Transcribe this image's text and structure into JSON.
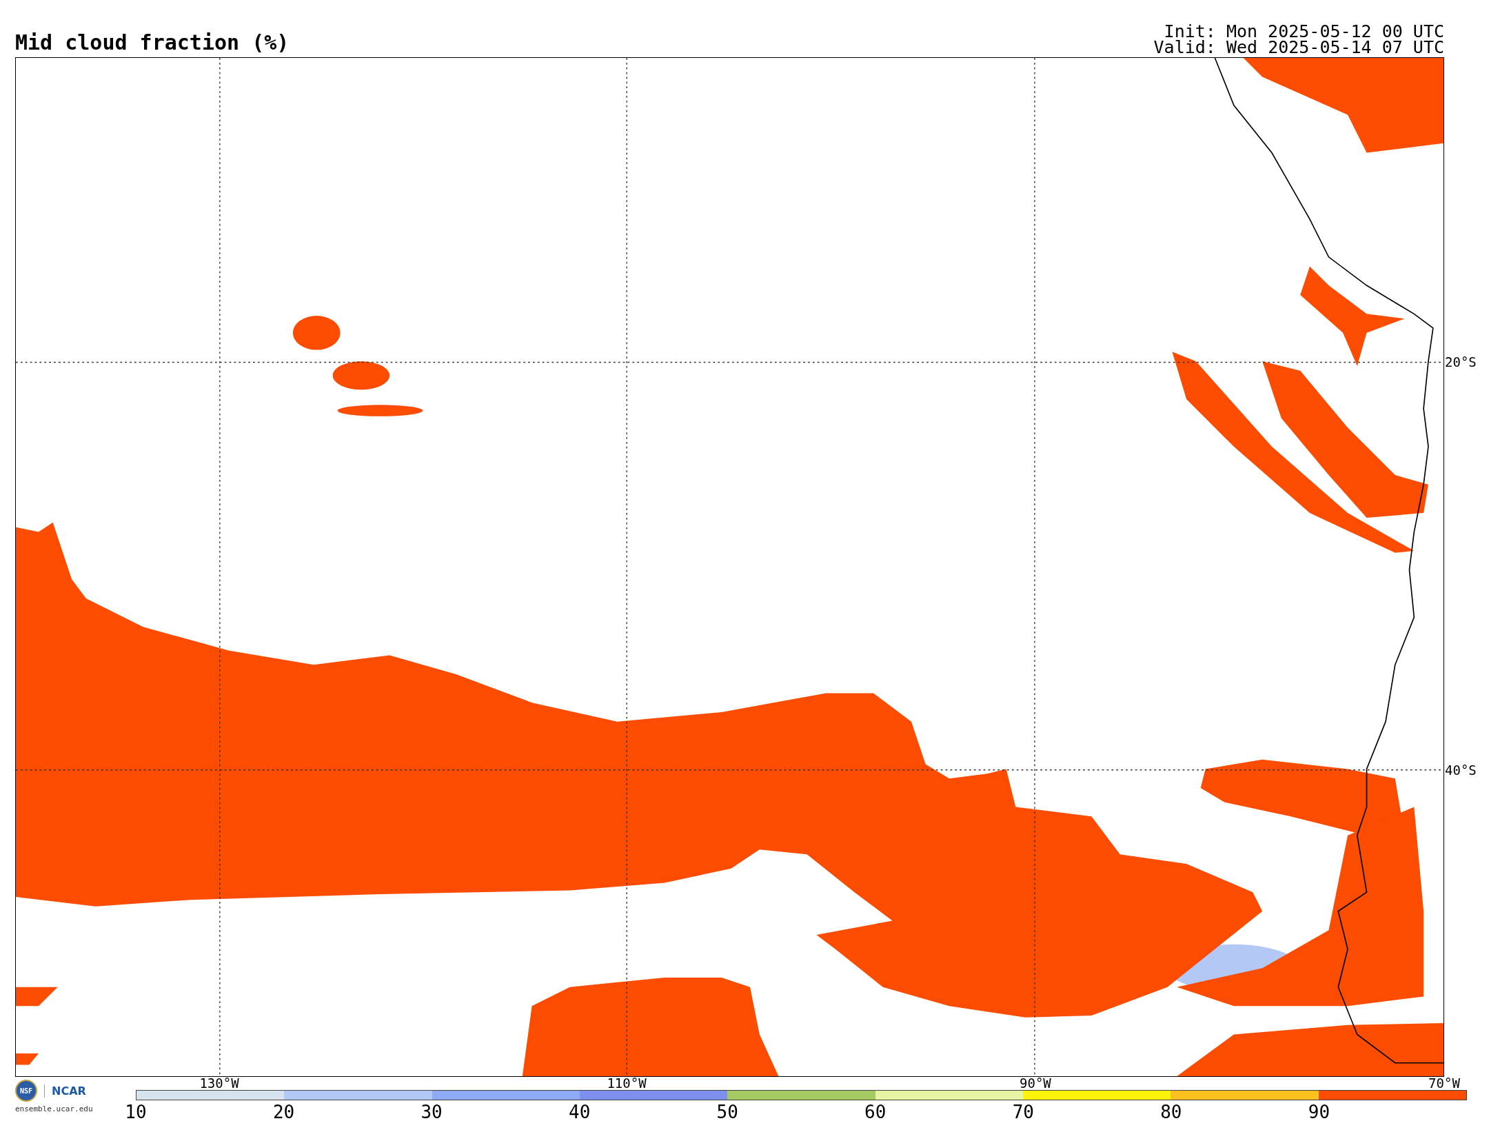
{
  "title": "Mid cloud fraction (%)",
  "init": "Init: Mon 2025-05-12 00 UTC",
  "valid": "Valid: Wed 2025-05-14 07 UTC",
  "map": {
    "lon_labels": [
      "130°W",
      "110°W",
      "90°W",
      "70°W"
    ],
    "lat_labels": [
      "20°S",
      "40°S"
    ]
  },
  "logos": {
    "nsf": "NSF",
    "ncar": "NCAR",
    "site": "ensemble.ucar.edu"
  },
  "colorbar": {
    "segments": [
      {
        "label": "10",
        "color": "#d6e2ee"
      },
      {
        "label": "20",
        "color": "#b4c8f6"
      },
      {
        "label": "30",
        "color": "#8eaaf4"
      },
      {
        "label": "40",
        "color": "#7e90ee"
      },
      {
        "label": "50",
        "color": "#a6ca62"
      },
      {
        "label": "60",
        "color": "#e6f4a4"
      },
      {
        "label": "70",
        "color": "#fcf20a"
      },
      {
        "label": "80",
        "color": "#fdc11f"
      },
      {
        "label": "90",
        "color": "#fc4c02"
      }
    ]
  }
}
